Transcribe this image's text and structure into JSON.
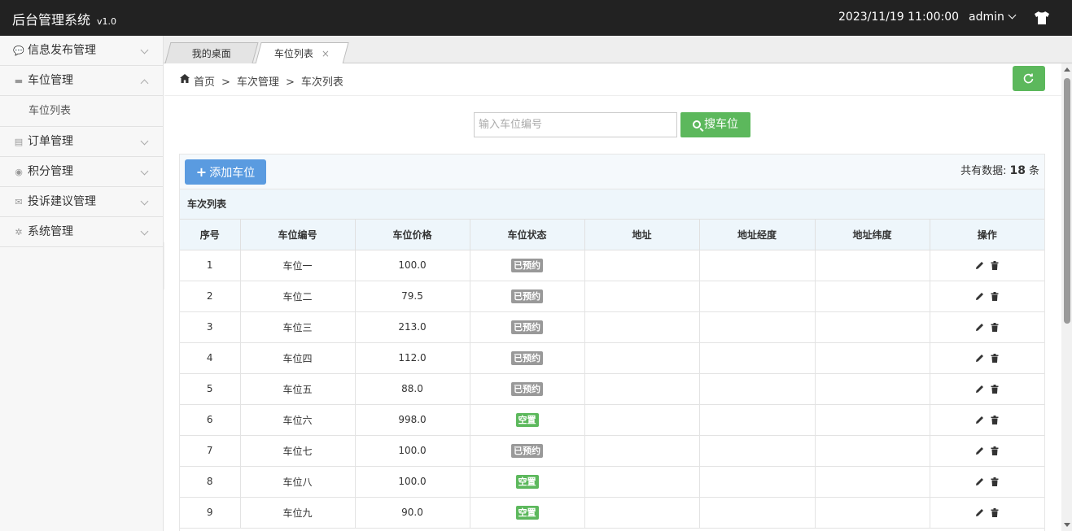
{
  "header": {
    "title": "后台管理系统",
    "version": "v1.0",
    "datetime": "2023/11/19 11:00:00",
    "user": "admin"
  },
  "sidebar": {
    "items": [
      {
        "label": "信息发布管理",
        "icon": "comment-icon",
        "expanded": false
      },
      {
        "label": "车位管理",
        "icon": "truck-icon",
        "expanded": true,
        "children": [
          {
            "label": "车位列表"
          }
        ]
      },
      {
        "label": "订单管理",
        "icon": "file-icon",
        "expanded": false
      },
      {
        "label": "积分管理",
        "icon": "database-icon",
        "expanded": false
      },
      {
        "label": "投诉建议管理",
        "icon": "envelope-icon",
        "expanded": false
      },
      {
        "label": "系统管理",
        "icon": "gear-icon",
        "expanded": false
      }
    ]
  },
  "tabs": [
    {
      "label": "我的桌面"
    },
    {
      "label": "车位列表",
      "closable": true,
      "close_glyph": "×"
    }
  ],
  "breadcrumb": {
    "items": [
      "首页",
      "车次管理",
      "车次列表"
    ],
    "separator": ">"
  },
  "search": {
    "placeholder": "输入车位编号",
    "value": "",
    "button_label": "搜车位"
  },
  "toolbar": {
    "add_label": "添加车位",
    "count_prefix": "共有数据:",
    "count_value": "18",
    "count_suffix": "条"
  },
  "list_title": "车次列表",
  "table": {
    "columns": [
      "序号",
      "车位编号",
      "车位价格",
      "车位状态",
      "地址",
      "地址经度",
      "地址纬度",
      "操作"
    ],
    "rows": [
      {
        "no": "1",
        "code": "车位一",
        "price": "100.0",
        "status": "已预约",
        "status_color": "gray",
        "address": "",
        "lng": "",
        "lat": ""
      },
      {
        "no": "2",
        "code": "车位二",
        "price": "79.5",
        "status": "已预约",
        "status_color": "gray",
        "address": "",
        "lng": "",
        "lat": ""
      },
      {
        "no": "3",
        "code": "车位三",
        "price": "213.0",
        "status": "已预约",
        "status_color": "gray",
        "address": "",
        "lng": "",
        "lat": ""
      },
      {
        "no": "4",
        "code": "车位四",
        "price": "112.0",
        "status": "已预约",
        "status_color": "gray",
        "address": "",
        "lng": "",
        "lat": ""
      },
      {
        "no": "5",
        "code": "车位五",
        "price": "88.0",
        "status": "已预约",
        "status_color": "gray",
        "address": "",
        "lng": "",
        "lat": ""
      },
      {
        "no": "6",
        "code": "车位六",
        "price": "998.0",
        "status": "空置",
        "status_color": "green",
        "address": "",
        "lng": "",
        "lat": ""
      },
      {
        "no": "7",
        "code": "车位七",
        "price": "100.0",
        "status": "已预约",
        "status_color": "gray",
        "address": "",
        "lng": "",
        "lat": ""
      },
      {
        "no": "8",
        "code": "车位八",
        "price": "100.0",
        "status": "空置",
        "status_color": "green",
        "address": "",
        "lng": "",
        "lat": ""
      },
      {
        "no": "9",
        "code": "车位九",
        "price": "90.0",
        "status": "空置",
        "status_color": "green",
        "address": "",
        "lng": "",
        "lat": ""
      }
    ]
  },
  "colors": {
    "header_bg": "#222222",
    "primary_green": "#5cb85c",
    "primary_blue": "#5a9be0",
    "badge_gray": "#999999"
  }
}
